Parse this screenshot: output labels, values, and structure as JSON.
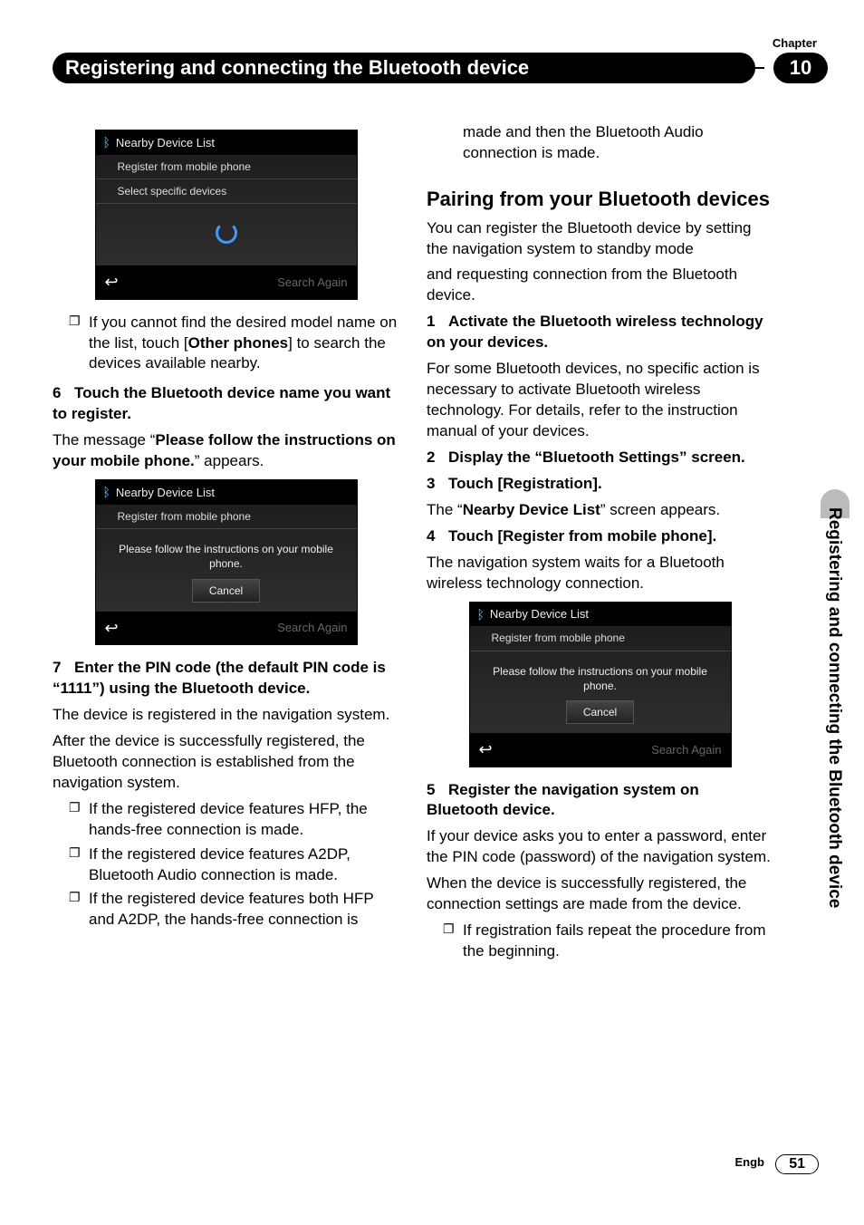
{
  "chapter": {
    "label": "Chapter",
    "number": "10"
  },
  "title": "Registering and connecting the Bluetooth device",
  "sideTab": "Registering and connecting the Bluetooth device",
  "footer": {
    "lang": "Engb",
    "page": "51"
  },
  "screenshots": {
    "s1": {
      "header": "Nearby Device List",
      "row1": "Register from mobile phone",
      "row2": "Select specific devices",
      "searchAgain": "Search Again"
    },
    "s2": {
      "header": "Nearby Device List",
      "row1": "Register from mobile phone",
      "msg1": "Please follow the instructions on your mobile",
      "msg2": "phone.",
      "cancel": "Cancel",
      "searchAgain": "Search Again"
    },
    "s3": {
      "header": "Nearby Device List",
      "row1": "Register from mobile phone",
      "msg1": "Please follow the instructions on your mobile",
      "msg2": "phone.",
      "cancel": "Cancel",
      "searchAgain": "Search Again"
    }
  },
  "col1": {
    "note1a": "If you cannot find the desired model name on the list, touch [",
    "note1b": "Other phones",
    "note1c": "] to search the devices available nearby.",
    "step6num": "6",
    "step6": "Touch the Bluetooth device name you want to register.",
    "step6body_a": "The message “",
    "step6body_b": "Please follow the instructions on your mobile phone.",
    "step6body_c": "” appears.",
    "step7num": "7",
    "step7": "Enter the PIN code (the default PIN code is “1111”) using the Bluetooth device.",
    "step7body1": "The device is registered in the navigation system.",
    "step7body2": "After the device is successfully registered, the Bluetooth connection is established from the navigation system.",
    "step7li1": "If the registered device features HFP, the hands-free connection is made.",
    "step7li2": "If the registered device features A2DP, Bluetooth Audio connection is made.",
    "step7li3": "If the registered device features both HFP and A2DP, the hands-free connection is made and then the Bluetooth Audio connection is made.",
    "subheading": "Pairing from your Bluetooth devices",
    "subbody": "You can register the Bluetooth device by setting the navigation system to standby mode"
  },
  "col2": {
    "lead": "and requesting connection from the Bluetooth device.",
    "step1num": "1",
    "step1": "Activate the Bluetooth wireless technology on your devices.",
    "step1body": "For some Bluetooth devices, no specific action is necessary to activate Bluetooth wireless technology. For details, refer to the instruction manual of your devices.",
    "step2num": "2",
    "step2": "Display the “Bluetooth Settings” screen.",
    "step3num": "3",
    "step3": "Touch [Registration].",
    "step3body_a": "The “",
    "step3body_b": "Nearby Device List",
    "step3body_c": "” screen appears.",
    "step4num": "4",
    "step4": "Touch [Register from mobile phone].",
    "step4body": "The navigation system waits for a Bluetooth wireless technology connection.",
    "step5num": "5",
    "step5": "Register the navigation system on Bluetooth device.",
    "step5body1": "If your device asks you to enter a password, enter the PIN code (password) of the navigation system.",
    "step5body2": "When the device is successfully registered, the connection settings are made from the device.",
    "step5li1": "If registration fails repeat the procedure from the beginning."
  }
}
